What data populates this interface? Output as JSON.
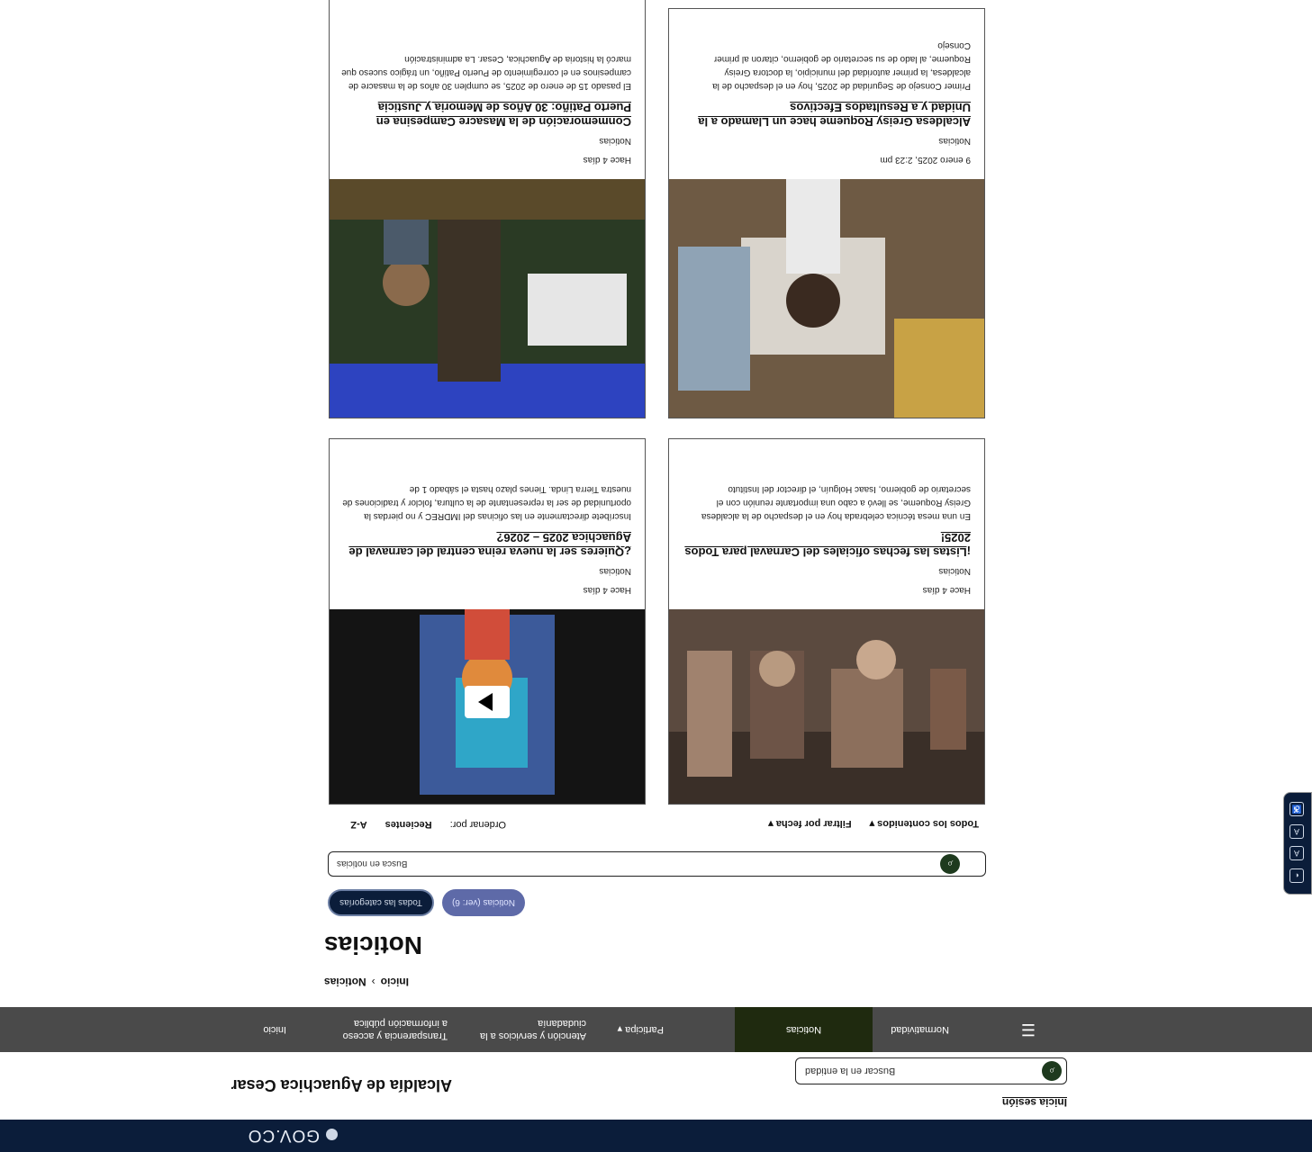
{
  "gov": {
    "logo_text": "GOV.CO"
  },
  "header": {
    "site_title": "Alcaldía de Aguachica Cesar",
    "login_label": "Inicia sesión",
    "search_placeholder": "Buscar en la entidad"
  },
  "nav": {
    "items": [
      "Inicio",
      "Transparencia y acceso a información pública",
      "Atención y servicios a la ciudadanía",
      "Participa",
      "Noticias",
      "Normatividad"
    ],
    "transparencia_line1": "Transparencia y acceso",
    "transparencia_line2": "a información pública",
    "atencion_line1": "Atención y servicios a la",
    "atencion_line2": "ciudadanía",
    "participa_label": "Participa",
    "noticias_label": "Noticias",
    "normatividad_label": "Normatividad",
    "inicio_label": "Inicio"
  },
  "breadcrumb": {
    "home": "Inicio",
    "separator": "›",
    "current": "Noticias"
  },
  "page": {
    "title": "Noticias",
    "chip_all": "Todas las categorías",
    "chip_noticias": "Noticias (ver: 6)",
    "news_search_placeholder": "Busca en noticias",
    "sort_label": "Ordenar por:",
    "sort_recent": "Recientes",
    "sort_az": "A-Z",
    "filter_date": "Filtrar por fecha",
    "filter_contents": "Todos los contenidos"
  },
  "cards": [
    {
      "date": "Hace 4 días",
      "category": "Noticias",
      "title": "¡Listas las fechas oficiales del Carnaval para Todos 2025!",
      "excerpt": "En una mesa técnica celebrada hoy en el despacho de la alcaldesa Greisy Roqueme, se llevó a cabo una importante reunión con el secretario de gobierno, Isaac Holguín, el director del Instituto"
    },
    {
      "date": "Hace 4 días",
      "category": "Noticias",
      "title": "¿Quieres ser la nueva reina central del carnaval de Aguachica 2025 – 2026?",
      "excerpt": "Inscríbete directamente en las oficinas del IMDREC y no pierdas la oportunidad de ser la representante de la cultura, folclor y tradiciones de nuestra Tierra Linda. Tienes plazo hasta el sábado 1 de"
    },
    {
      "date": "9 enero 2025, 2:23 pm",
      "category": "Noticias",
      "title": "Alcaldesa Greisy Roqueme hace un Llamado a la Unidad y a Resultados Efectivos",
      "excerpt": "Primer Consejo de Seguridad de 2025, hoy en el despacho de la alcaldesa, la primer autoridad del municipio, la doctora Greisy Roqueme, al lado de su secretario de gobierno, citaron al primer Consejo"
    },
    {
      "date": "Hace 4 días",
      "category": "Noticias",
      "title": "Conmemoración de la Masacre Campesina en Puerto Patiño: 30 Años de Memoria y Justicia",
      "excerpt": "El pasado 15 de enero de 2025, se cumplen 30 años de la masacre de campesinos en el corregimiento de Puerto Patiño, un trágico suceso que marcó la historia de Aguachica, Cesar. La administración"
    }
  ],
  "a11y": {
    "items": [
      "contrast-icon",
      "font-minus-icon",
      "font-plus-icon",
      "accessibility-icon"
    ]
  }
}
